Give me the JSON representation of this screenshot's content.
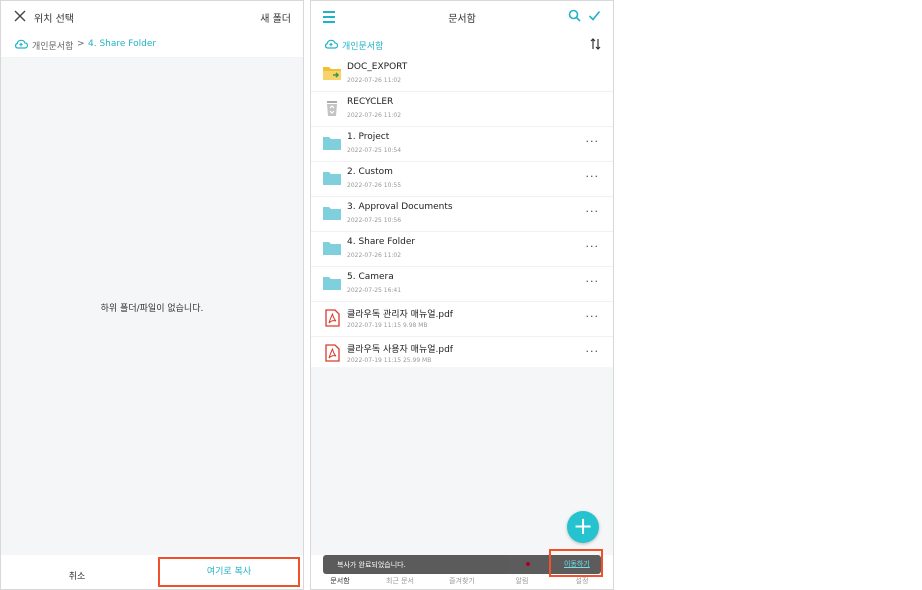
{
  "left_panel": {
    "title": "위치 선택",
    "new_folder": "새 폴더",
    "breadcrumb": {
      "root": "개인문서함",
      "separator": ">",
      "current": "4. Share Folder"
    },
    "empty_message": "하위 폴더/파일이 없습니다.",
    "cancel_label": "취소",
    "copy_here_label": "여기로 복사"
  },
  "right_panel": {
    "title": "문서함",
    "breadcrumb_root": "개인문서함",
    "items": [
      {
        "name": "DOC_EXPORT",
        "meta": "2022-07-26 11:02",
        "icon": "export-folder-icon",
        "more": ""
      },
      {
        "name": "RECYCLER",
        "meta": "2022-07-26 11:02",
        "icon": "recycle-bin-icon",
        "more": ""
      },
      {
        "name": "1. Project",
        "meta": "2022-07-25 10:54",
        "icon": "folder-icon",
        "more": "···"
      },
      {
        "name": "2. Custom",
        "meta": "2022-07-26 10:55",
        "icon": "folder-icon",
        "more": "···"
      },
      {
        "name": "3. Approval Documents",
        "meta": "2022-07-25 10:56",
        "icon": "folder-icon",
        "more": "···"
      },
      {
        "name": "4. Share Folder",
        "meta": "2022-07-26 11:02",
        "icon": "folder-icon",
        "more": "···"
      },
      {
        "name": "5. Camera",
        "meta": "2022-07-25 16:41",
        "icon": "folder-icon",
        "more": "···"
      },
      {
        "name": "클라우독 관리자 매뉴얼.pdf",
        "meta": "2022-07-19 11:15   9.98 MB",
        "icon": "pdf-icon",
        "more": "···"
      },
      {
        "name": "클라우독 사용자 매뉴얼.pdf",
        "meta": "2022-07-19 11:15   25.99 MB",
        "icon": "pdf-icon",
        "more": "···"
      }
    ],
    "fab_label": "+",
    "tabs": [
      "문서함",
      "최근 문서",
      "즐겨찾기",
      "알림",
      "설정"
    ],
    "toast": {
      "message": "복사가 완료되었습니다.",
      "action": "이동하기"
    }
  },
  "colors": {
    "accent": "#20b3c6",
    "highlight": "#f0502c",
    "folder": "#7fd0dc",
    "pdf": "#d93a2b"
  }
}
